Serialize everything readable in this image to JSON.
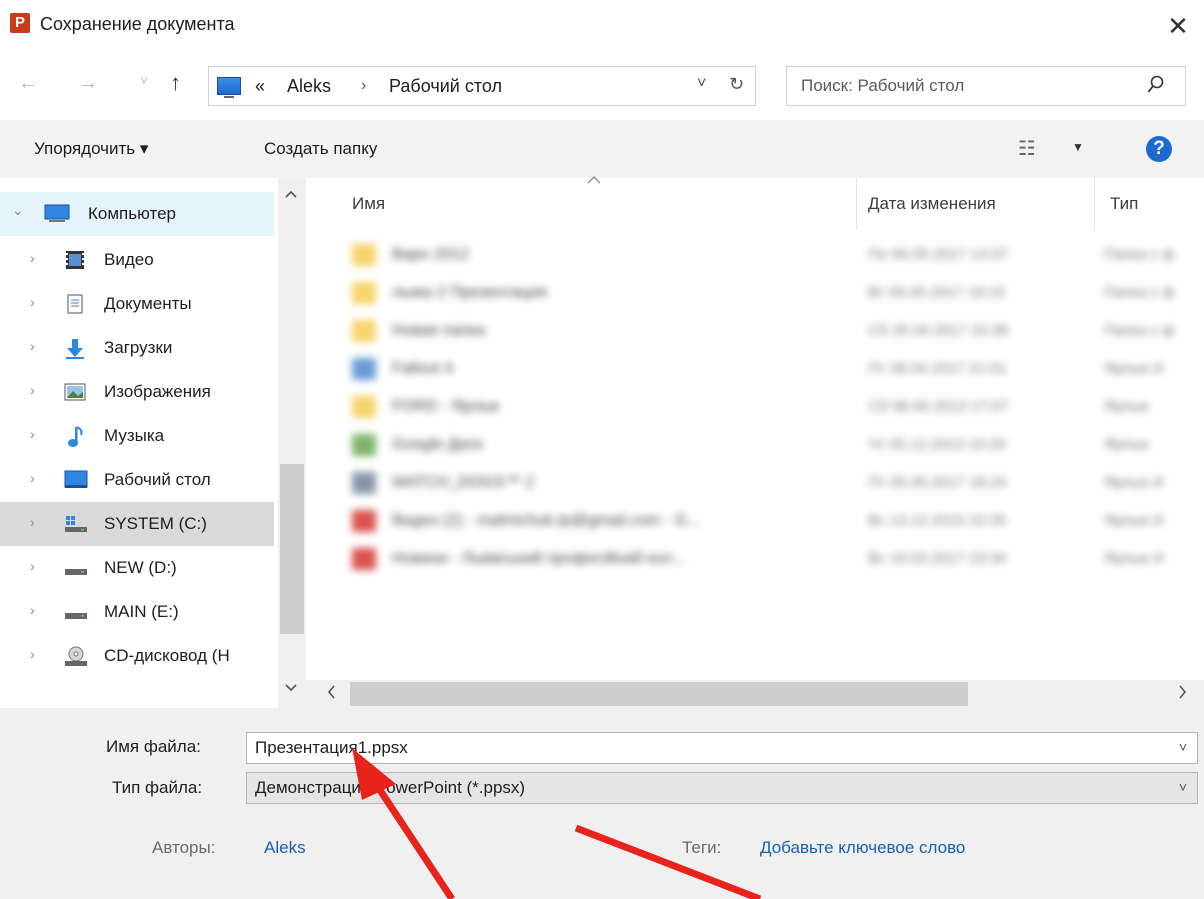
{
  "window": {
    "app_icon_letter": "P",
    "title": "Сохранение документа",
    "close_glyph": "✕"
  },
  "nav": {
    "back": "←",
    "forward": "→",
    "recent": "˅",
    "up": "↑",
    "address": {
      "overflow": "«",
      "crumbs": [
        "Aleks",
        "Рабочий стол"
      ],
      "separator": "›",
      "dropdown": "˅",
      "refresh": "↻"
    },
    "search": {
      "placeholder": "Поиск: Рабочий стол"
    }
  },
  "toolbar": {
    "organize": "Упорядочить ▾",
    "new_folder": "Создать папку",
    "view_glyph": "☷",
    "view_drop": "▼",
    "help": "?"
  },
  "tree": [
    {
      "label": "Компьютер",
      "icon": "computer-icon",
      "state": "selected"
    },
    {
      "label": "Видео",
      "icon": "video-icon"
    },
    {
      "label": "Документы",
      "icon": "documents-icon"
    },
    {
      "label": "Загрузки",
      "icon": "downloads-icon"
    },
    {
      "label": "Изображения",
      "icon": "pictures-icon"
    },
    {
      "label": "Музыка",
      "icon": "music-icon"
    },
    {
      "label": "Рабочий стол",
      "icon": "desktop-icon"
    },
    {
      "label": "SYSTEM (C:)",
      "icon": "system-drive-icon",
      "state": "hover"
    },
    {
      "label": "NEW (D:)",
      "icon": "drive-icon"
    },
    {
      "label": "MAIN (E:)",
      "icon": "drive-icon"
    },
    {
      "label": "CD-дисковод (H",
      "icon": "cd-drive-icon"
    }
  ],
  "tree_chevrons": {
    "expanded": "⌄",
    "collapsed": "›"
  },
  "columns": {
    "name": "Имя",
    "date": "Дата изменения",
    "type": "Тип"
  },
  "files": [
    {
      "name": "Варн 2012",
      "date": "Пн 06.05.2017 14:07",
      "type": "Папка с ф",
      "icon_color": "#f6d36b"
    },
    {
      "name": "лыжа 2 Презентация",
      "date": "Вт 09.05.2017 19:15",
      "type": "Папка с ф",
      "icon_color": "#f6d36b"
    },
    {
      "name": "Новая папка",
      "date": "Сб 29.04.2017 10:36",
      "type": "Папка с ф",
      "icon_color": "#f6d36b"
    },
    {
      "name": "Fallout 4",
      "date": "Пт 28.04.2017 21:01",
      "type": "Ярлык И",
      "icon_color": "#6b9bd6"
    },
    {
      "name": "FORD - Ярлык",
      "date": "Сб 08.06.2013 17:07",
      "type": "Ярлык",
      "icon_color": "#f6d36b"
    },
    {
      "name": "Google Диск",
      "date": "Чт 05.12.2013 10:20",
      "type": "Ярлык",
      "icon_color": "#7fb36a"
    },
    {
      "name": "WATCH_DOGS™ 2",
      "date": "Пт 05.05.2017 18:24",
      "type": "Ярлык И",
      "icon_color": "#8896a8"
    },
    {
      "name": "Видео (2) - malmichuk.tp@gmail.com - G...",
      "date": "Вс 13.12.2015 22:35",
      "type": "Ярлык И",
      "icon_color": "#d9534f"
    },
    {
      "name": "Новини - Львівський професійний кол...",
      "date": "Вс 19.03.2017 23:34",
      "type": "Ярлык И",
      "icon_color": "#d9534f"
    }
  ],
  "form": {
    "filename_label": "Имя файла:",
    "filename_value": "Презентация1.ppsx",
    "filetype_label": "Тип файла:",
    "filetype_value": "Демонстрация PowerPoint (*.ppsx)",
    "authors_label": "Авторы:",
    "authors_value": "Aleks",
    "tags_label": "Теги:",
    "tags_value": "Добавьте ключевое слово",
    "dropdown_glyph": "˅"
  },
  "colors": {
    "annotation_arrow": "#e8231c",
    "selection": "#e5f3fb",
    "link": "#1a5fb4"
  }
}
